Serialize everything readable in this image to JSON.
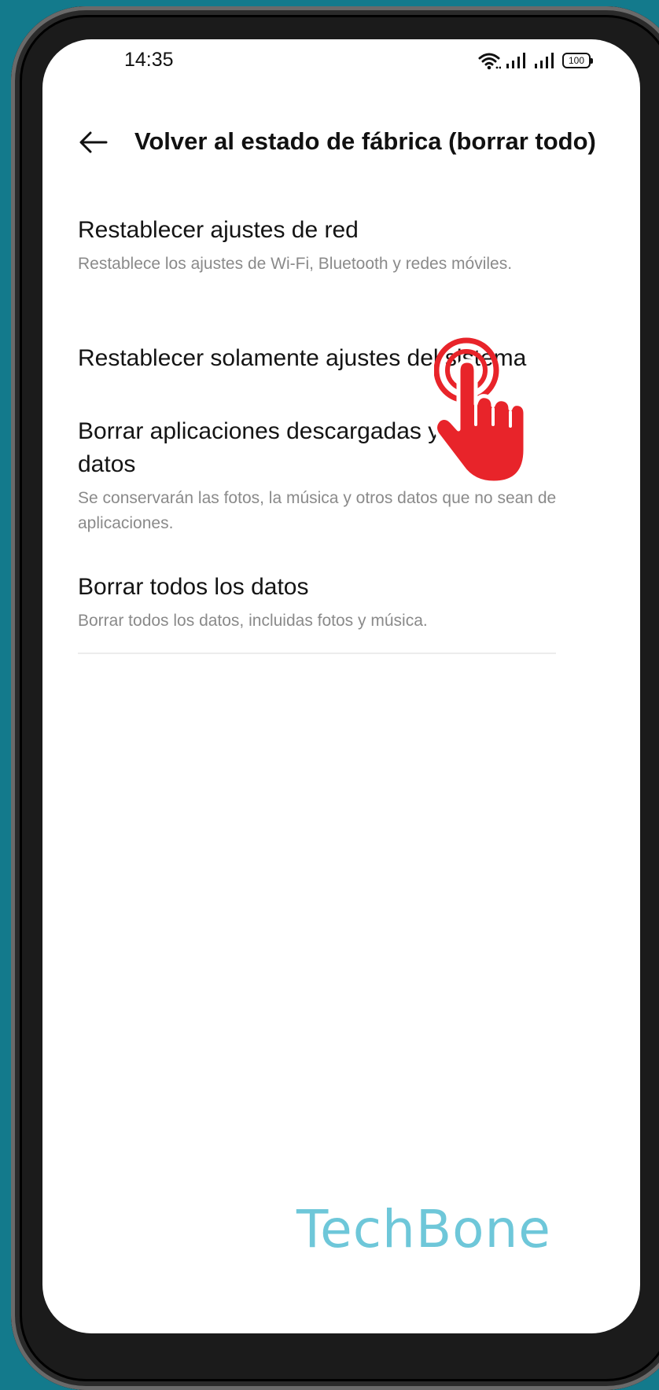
{
  "status_bar": {
    "time": "14:35",
    "battery": "100",
    "icons": [
      "wifi-icon",
      "signal-icon",
      "signal-icon",
      "battery-icon"
    ]
  },
  "header": {
    "back_icon": "arrow-left-icon",
    "title": "Volver al estado de fábrica (borrar todo)"
  },
  "options": [
    {
      "title": "Restablecer ajustes de red",
      "subtitle": "Restablece los ajustes de Wi-Fi, Bluetooth y redes móviles."
    },
    {
      "title": "Restablecer solamente ajustes del sistema",
      "subtitle": ""
    },
    {
      "title": "Borrar aplicaciones descargadas y sus datos",
      "subtitle": "Se conservarán las fotos, la música y otros datos que no sean de aplicaciones."
    },
    {
      "title": "Borrar todos los datos",
      "subtitle": "Borrar todos los datos, incluidas fotos y música."
    }
  ],
  "overlay": {
    "icon": "tap-hand-icon",
    "color": "#e8242a"
  },
  "watermark": "TechBone",
  "colors": {
    "background": "#137a8c",
    "watermark": "#62c3d6",
    "accent": "#e8242a"
  }
}
